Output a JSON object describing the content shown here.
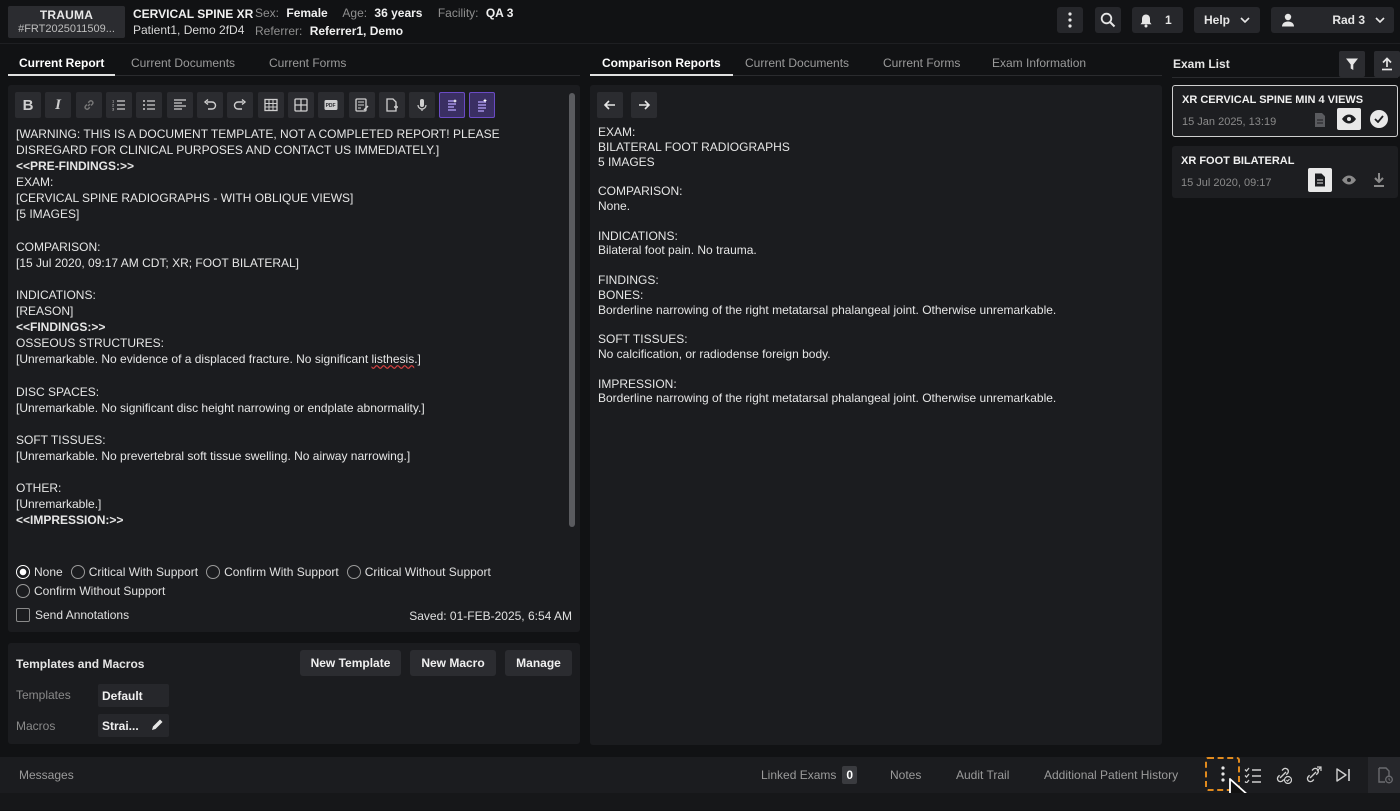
{
  "header": {
    "badge_title": "TRAUMA",
    "badge_sub": "#FRT2025011509...",
    "exam_title": "CERVICAL SPINE XR",
    "patient": "Patient1, Demo 2fD4",
    "sex_label": "Sex:",
    "sex_value": "Female",
    "age_label": "Age:",
    "age_value": "36 years",
    "facility_label": "Facility:",
    "facility_value": "QA 3",
    "referrer_label": "Referrer:",
    "referrer_value": "Referrer1, Demo",
    "notifications_count": "1",
    "help_label": "Help",
    "user_label": "Rad 3"
  },
  "left_tabs": [
    "Current Report",
    "Current Documents",
    "Current Forms"
  ],
  "mid_tabs": [
    "Comparison Reports",
    "Current Documents",
    "Current Forms",
    "Exam Information"
  ],
  "report": {
    "warning": "[WARNING: THIS IS A DOCUMENT TEMPLATE, NOT A COMPLETED REPORT! PLEASE DISREGARD FOR CLINICAL PURPOSES AND CONTACT US IMMEDIATELY.]",
    "pre_findings": "<<PRE-FINDINGS:>>",
    "exam_block": "EXAM:\n[CERVICAL SPINE RADIOGRAPHS - WITH OBLIQUE VIEWS]\n[5 IMAGES]\n\nCOMPARISON:\n[15 Jul 2020, 09:17 AM CDT; XR; FOOT BILATERAL]\n\nINDICATIONS:\n[REASON]\n",
    "findings": "<<FINDINGS:>>",
    "osseous_label": "OSSEOUS STRUCTURES:",
    "osseous_text_pre": "[Unremarkable. No evidence of a displaced fracture. No significant ",
    "osseous_text_sp": "listhesis",
    "osseous_text_post": ".]",
    "rest_block": "\nDISC SPACES:\n[Unremarkable. No significant disc height narrowing or endplate abnormality.]\n\nSOFT TISSUES:\n[Unremarkable. No prevertebral soft tissue swelling. No airway narrowing.]\n\nOTHER:\n[Unremarkable.]\n",
    "impression": "<<IMPRESSION:>>"
  },
  "criticality": {
    "options": [
      "None",
      "Critical With Support",
      "Confirm With Support",
      "Critical Without Support",
      "Confirm Without Support"
    ],
    "selected": "None"
  },
  "send_annotations_label": "Send Annotations",
  "saved_text": "Saved: 01-FEB-2025, 6:54 AM",
  "templates_panel": {
    "title": "Templates and Macros",
    "new_template": "New Template",
    "new_macro": "New Macro",
    "manage": "Manage",
    "templates_label": "Templates",
    "templates_value": "Default",
    "macros_label": "Macros",
    "macros_value": "Strai..."
  },
  "comparison": {
    "text": "EXAM:\nBILATERAL FOOT RADIOGRAPHS\n5 IMAGES\n\nCOMPARISON:\nNone.\n\nINDICATIONS:\nBilateral foot pain. No trauma.\n\nFINDINGS:\nBONES:\nBorderline narrowing of the right metatarsal phalangeal joint. Otherwise unremarkable.\n\nSOFT TISSUES:\nNo calcification, or radiodense foreign body.\n\nIMPRESSION:\nBorderline narrowing of the right metatarsal phalangeal joint. Otherwise unremarkable."
  },
  "exam_list": {
    "title": "Exam List",
    "items": [
      {
        "title": "XR CERVICAL SPINE MIN 4 VIEWS",
        "date": "15 Jan 2025, 13:19"
      },
      {
        "title": "XR FOOT BILATERAL",
        "date": "15 Jul 2020, 09:17"
      }
    ]
  },
  "bottom": {
    "messages": "Messages",
    "linked_exams": "Linked Exams",
    "linked_count": "0",
    "notes": "Notes",
    "audit_trail": "Audit Trail",
    "history": "Additional Patient History"
  },
  "colors": {
    "accent_purple": "#6a4bc4",
    "highlight_orange": "#e08a1e"
  }
}
